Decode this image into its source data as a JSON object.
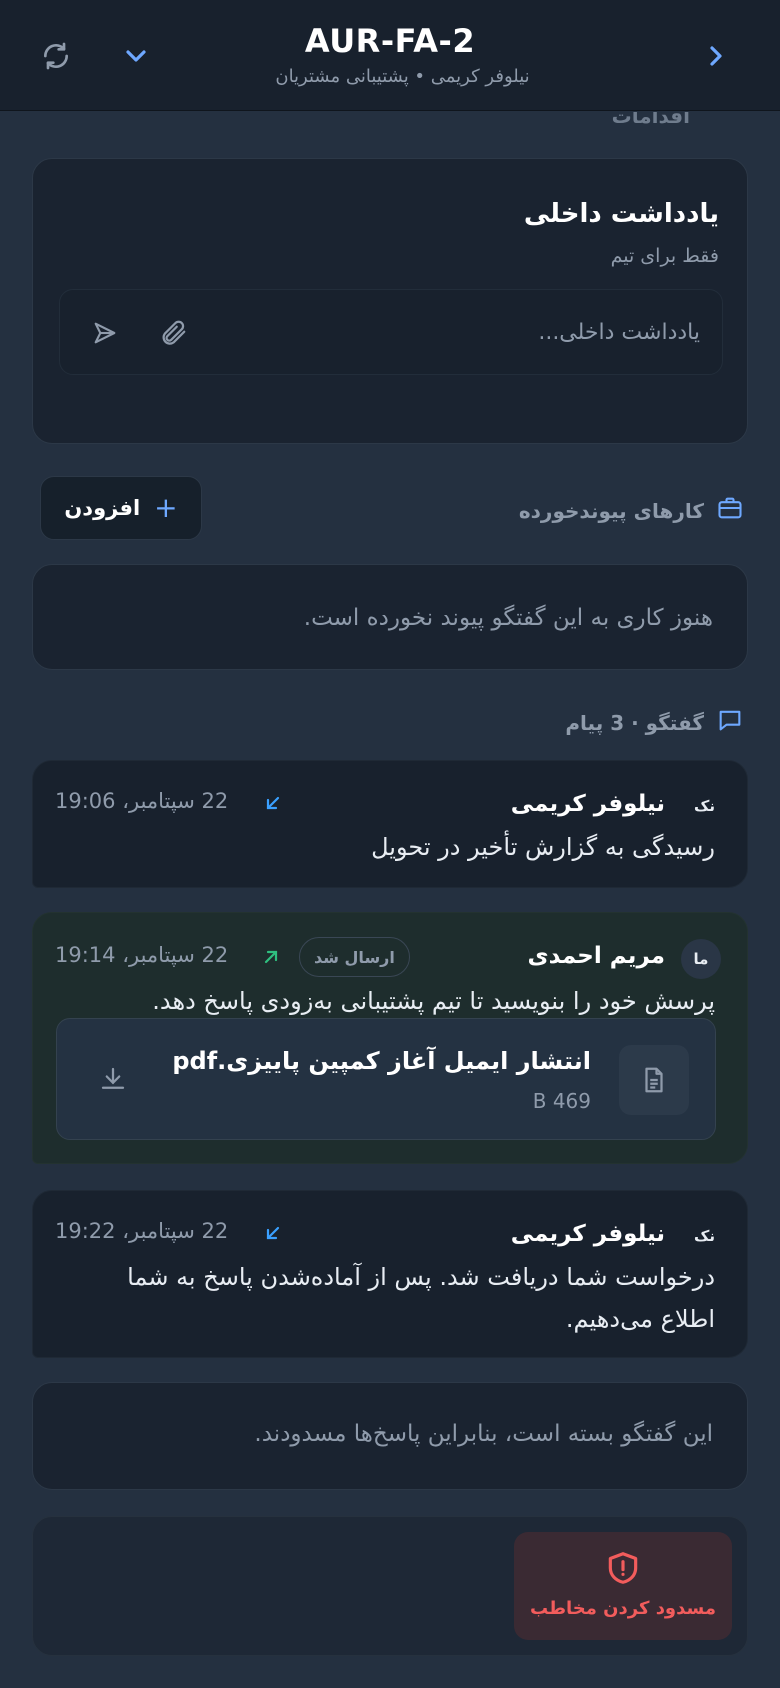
{
  "header": {
    "title": "AUR-FA-2",
    "subtitle": "نیلوفر کریمی • پشتیبانی مشتریان"
  },
  "actions_section": {
    "label": "اقدامات"
  },
  "internal_note": {
    "title": "یادداشت داخلی",
    "subtitle": "فقط برای تیم",
    "placeholder": "یادداشت داخلی..."
  },
  "linked_tasks": {
    "label": "کارهای پیوندخورده",
    "add_label": "افزودن",
    "empty_text": "هنوز کاری به این گفتگو پیوند نخورده است."
  },
  "conversation": {
    "label": "گفتگو · 3 پیام",
    "messages": [
      {
        "badge": "نک",
        "name": "نیلوفر کریمی",
        "time": "22 سپتامبر، 19:06",
        "direction": "incoming",
        "body": "رسیدگی به گزارش تأخیر در تحویل"
      },
      {
        "badge": "ما",
        "name": "مریم احمدی",
        "status": "ارسال شد",
        "time": "22 سپتامبر، 19:14",
        "direction": "outgoing",
        "body": "پرسش خود را بنویسید تا تیم پشتیبانی به‌زودی پاسخ دهد.",
        "attachment": {
          "name": "انتشار ایمیل آغاز کمپین پاییزی.pdf",
          "size": "469 B"
        }
      },
      {
        "badge": "نک",
        "name": "نیلوفر کریمی",
        "time": "22 سپتامبر، 19:22",
        "direction": "incoming",
        "body_line1": "درخواست شما دریافت شد. پس از آماده‌شدن پاسخ به شما",
        "body_line2": "اطلاع می‌دهیم."
      }
    ]
  },
  "closed_notice": "این گفتگو بسته است، بنابراین پاسخ‌ها مسدودند.",
  "block_button": {
    "label": "مسدود کردن مخاطب"
  },
  "colors": {
    "accent": "#6ea8ff",
    "incoming_arrow": "#3aa0ff",
    "outgoing_arrow": "#2fbf7f",
    "danger": "#f25c5c",
    "background": "#243040"
  }
}
